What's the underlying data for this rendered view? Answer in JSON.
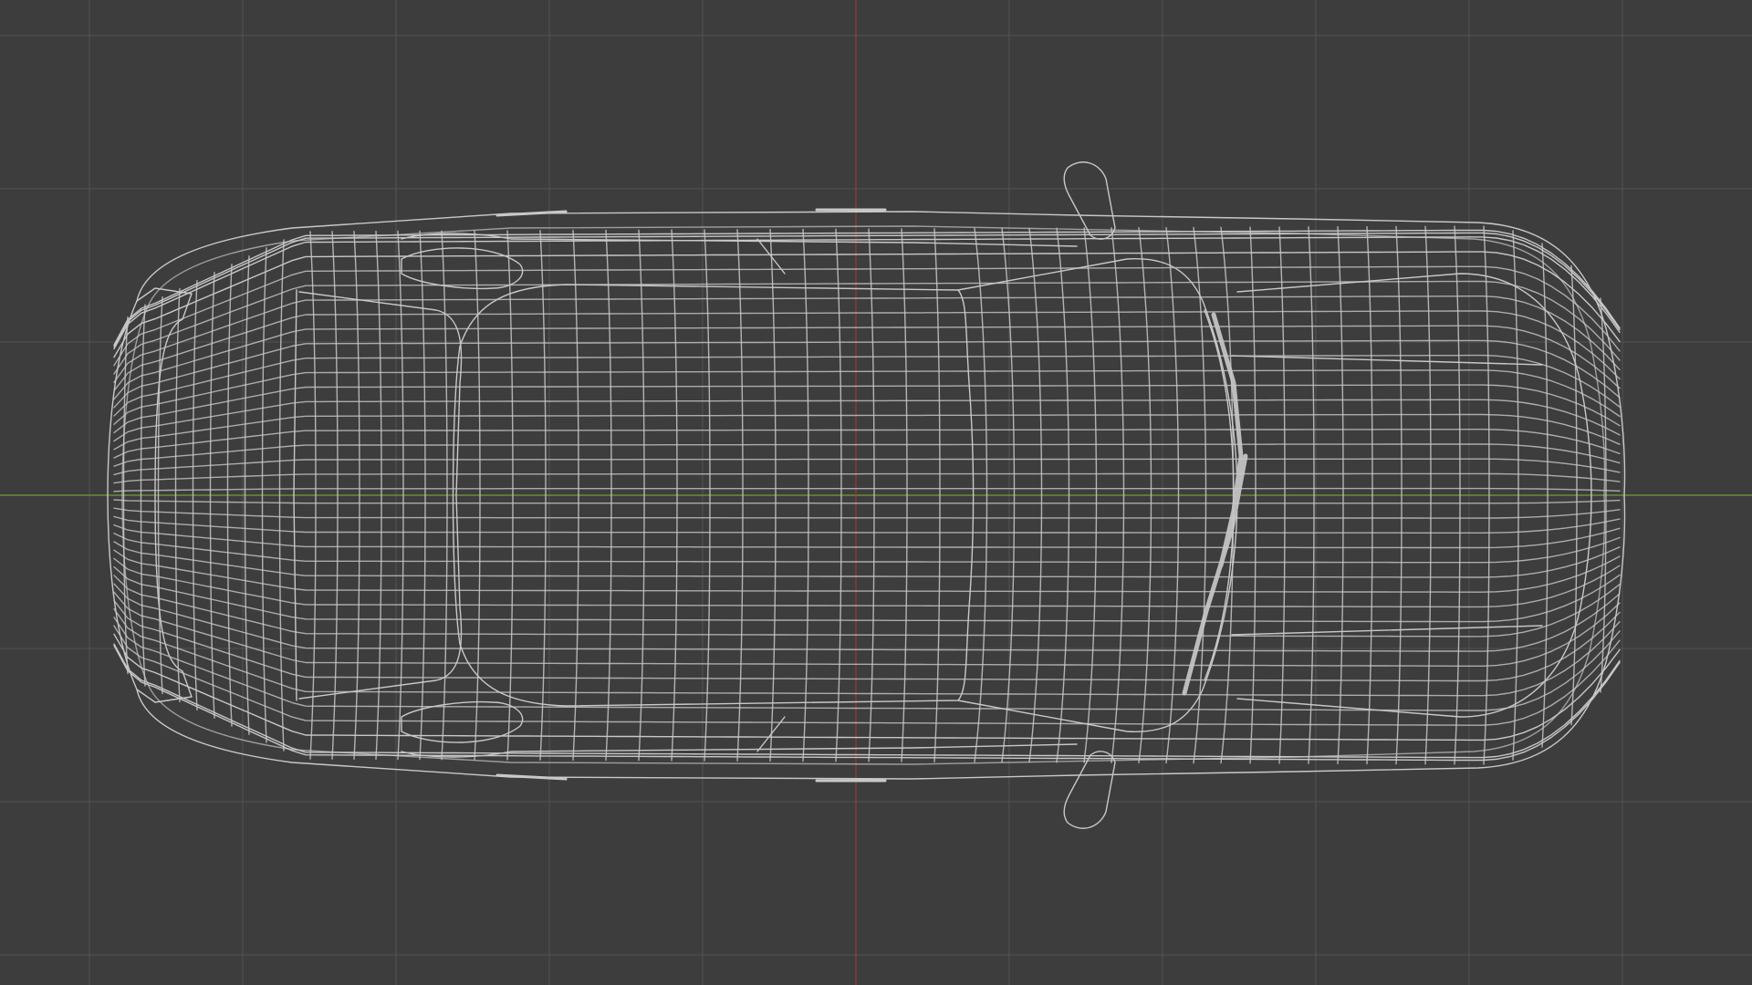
{
  "viewport": {
    "view": "top-orthographic",
    "shading": "wireframe",
    "model": "car-wireframe",
    "colors": {
      "background": "#3d3d3d",
      "grid": "#525252",
      "axis_x": "#7a9a3a",
      "axis_y": "#9a3a3a",
      "wire": "#c8c8c8",
      "wire_dense": "#d8d8d8"
    },
    "grid_visible": true,
    "overlays_visible": true
  }
}
